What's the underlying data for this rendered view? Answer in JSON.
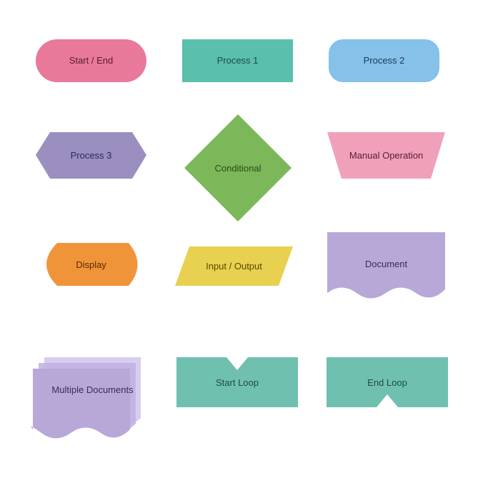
{
  "shapes": {
    "start_end": {
      "label": "Start / End"
    },
    "process1": {
      "label": "Process 1"
    },
    "process2": {
      "label": "Process 2"
    },
    "process3": {
      "label": "Process 3"
    },
    "conditional": {
      "label": "Conditional"
    },
    "manual_operation": {
      "label": "Manual Operation"
    },
    "display": {
      "label": "Display"
    },
    "input_output": {
      "label": "Input / Output"
    },
    "document": {
      "label": "Document"
    },
    "multiple_documents": {
      "label": "Multiple Documents"
    },
    "start_loop": {
      "label": "Start Loop"
    },
    "end_loop": {
      "label": "End Loop"
    }
  },
  "colors": {
    "pink": "#e8799a",
    "teal": "#5bbfad",
    "lightblue": "#85c1e9",
    "purple": "#9b8fc0",
    "green": "#7cb85a",
    "pink_trap": "#f0a0b8",
    "orange": "#f0943a",
    "yellow": "#e8d050",
    "lavender": "#b8a8d8",
    "teal_loop": "#70c0b0"
  }
}
